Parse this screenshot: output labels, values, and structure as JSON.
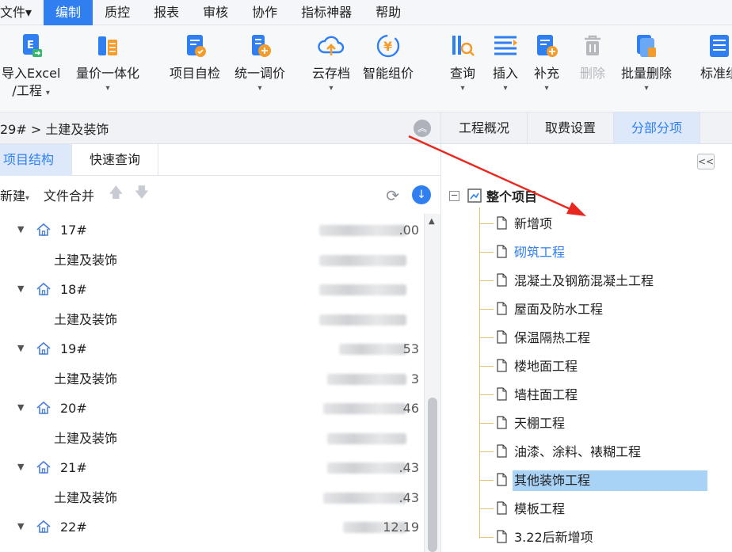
{
  "menubar": {
    "items": [
      "文件▾",
      "编制",
      "质控",
      "报表",
      "审核",
      "协作",
      "指标神器",
      "帮助"
    ],
    "active_index": 1
  },
  "ribbon": {
    "buttons": [
      {
        "label": "导入Excel",
        "label2": "/工程",
        "icon": "excel-import-icon",
        "has_dropdown": true,
        "disabled": false
      },
      {
        "label": "量价一体化",
        "icon": "price-integration-icon",
        "has_dropdown": true,
        "disabled": false
      },
      {
        "label": "项目自检",
        "icon": "self-check-icon",
        "has_dropdown": false,
        "disabled": false
      },
      {
        "label": "统一调价",
        "icon": "price-adjust-icon",
        "has_dropdown": true,
        "disabled": false
      },
      {
        "label": "云存档",
        "icon": "cloud-archive-icon",
        "has_dropdown": true,
        "disabled": false
      },
      {
        "label": "智能组价",
        "icon": "smart-pricing-icon",
        "has_dropdown": false,
        "disabled": false
      },
      {
        "label": "查询",
        "icon": "query-icon",
        "has_dropdown": true,
        "disabled": false
      },
      {
        "label": "插入",
        "icon": "insert-icon",
        "has_dropdown": true,
        "disabled": false
      },
      {
        "label": "补充",
        "icon": "supplement-icon",
        "has_dropdown": true,
        "disabled": false
      },
      {
        "label": "删除",
        "icon": "trash-icon",
        "has_dropdown": false,
        "disabled": true
      },
      {
        "label": "批量删除",
        "icon": "batch-delete-icon",
        "has_dropdown": true,
        "disabled": false
      },
      {
        "label": "标准组",
        "icon": "standard-group-icon",
        "has_dropdown": false,
        "disabled": false
      }
    ],
    "accent": "#2f7ff0"
  },
  "left": {
    "breadcrumb": "29# > 土建及装饰",
    "tabs": [
      "项目结构",
      "快速查询"
    ],
    "toolbar": {
      "new_label": "新建",
      "new_dropdown": "▾",
      "merge_label": "文件合并"
    },
    "tree": [
      {
        "type": "group",
        "name": "17#",
        "value": ".00"
      },
      {
        "type": "child",
        "name": "土建及装饰",
        "value": ""
      },
      {
        "type": "group",
        "name": "18#",
        "value": ""
      },
      {
        "type": "child",
        "name": "土建及装饰",
        "value": ""
      },
      {
        "type": "group",
        "name": "19#",
        "value": "53"
      },
      {
        "type": "child",
        "name": "土建及装饰",
        "value": "3"
      },
      {
        "type": "group",
        "name": "20#",
        "value": "46"
      },
      {
        "type": "child",
        "name": "土建及装饰",
        "value": ""
      },
      {
        "type": "group",
        "name": "21#",
        "value": ".43"
      },
      {
        "type": "child",
        "name": "土建及装饰",
        "value": ".43"
      },
      {
        "type": "group",
        "name": "22#",
        "value": "12.19"
      }
    ]
  },
  "right": {
    "tabs": [
      "工程概况",
      "取费设置",
      "分部分项"
    ],
    "active_tab": 2,
    "collapse_label": "<<",
    "root_label": "整个项目",
    "items": [
      {
        "label": "新增项",
        "style": "normal"
      },
      {
        "label": "砌筑工程",
        "style": "link"
      },
      {
        "label": "混凝土及钢筋混凝土工程",
        "style": "normal"
      },
      {
        "label": "屋面及防水工程",
        "style": "normal"
      },
      {
        "label": "保温隔热工程",
        "style": "normal"
      },
      {
        "label": "楼地面工程",
        "style": "normal"
      },
      {
        "label": "墙柱面工程",
        "style": "normal"
      },
      {
        "label": "天棚工程",
        "style": "normal"
      },
      {
        "label": "油漆、涂料、裱糊工程",
        "style": "normal"
      },
      {
        "label": "其他装饰工程",
        "style": "selected"
      },
      {
        "label": "模板工程",
        "style": "normal"
      },
      {
        "label": "3.22后新增项",
        "style": "normal"
      }
    ]
  }
}
